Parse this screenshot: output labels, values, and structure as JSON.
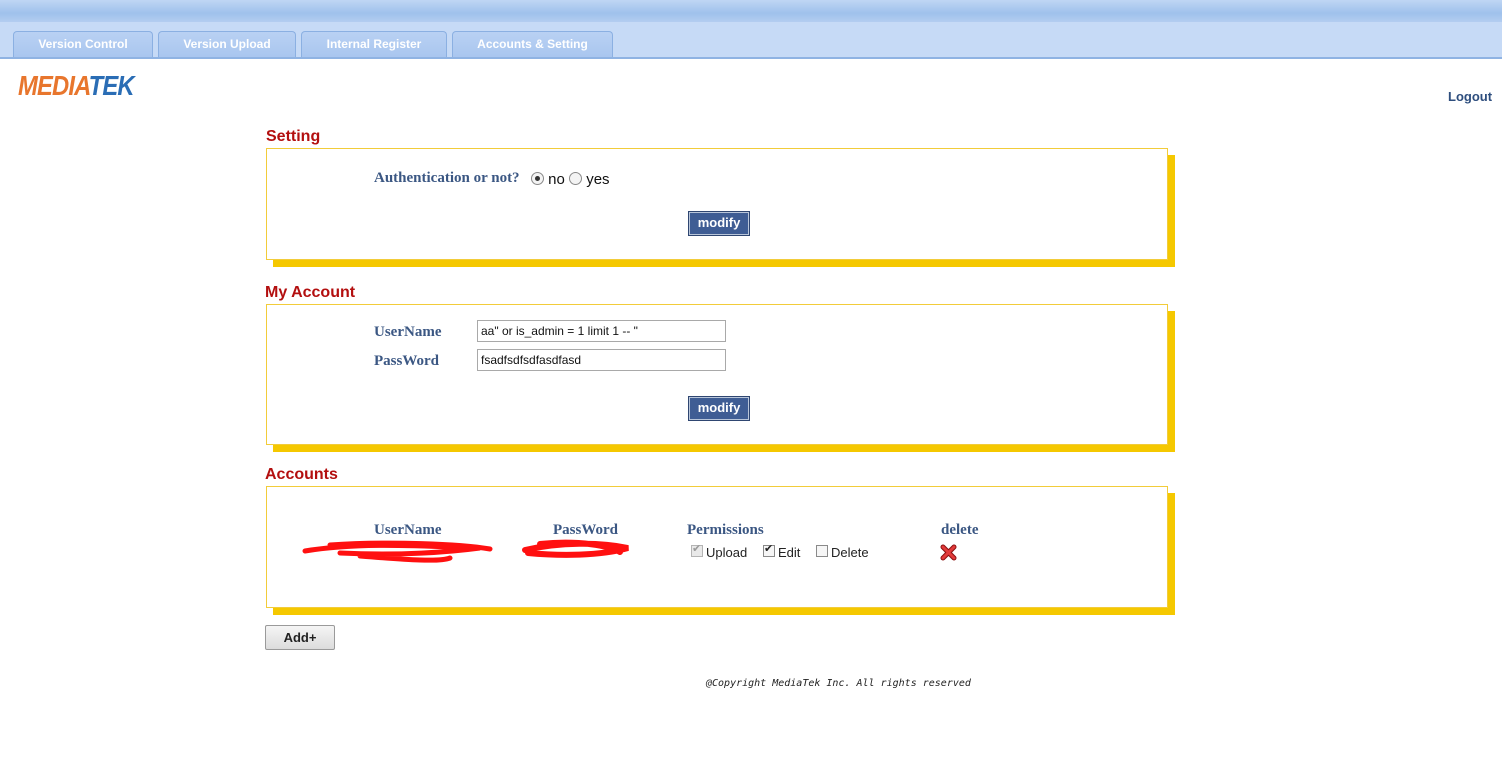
{
  "tabs": [
    {
      "label": "Version Control"
    },
    {
      "label": "Version Upload"
    },
    {
      "label": "Internal Register"
    },
    {
      "label": "Accounts & Setting"
    }
  ],
  "brand": {
    "logo_part1": "MEDIA",
    "logo_part2": "TEK"
  },
  "header": {
    "logout_label": "Logout"
  },
  "setting": {
    "title": "Setting",
    "auth_label": "Authentication or not?",
    "option_no": "no",
    "option_yes": "yes",
    "selected": "no",
    "modify_label": "modify"
  },
  "my_account": {
    "title": "My Account",
    "username_label": "UserName",
    "password_label": "PassWord",
    "username_value": "aa\" or is_admin = 1 limit 1 -- \"",
    "password_value": "fsadfsdfsdfasdfasd",
    "modify_label": "modify"
  },
  "accounts": {
    "title": "Accounts",
    "columns": {
      "username": "UserName",
      "password": "PassWord",
      "permissions": "Permissions",
      "delete": "delete"
    },
    "rows": [
      {
        "username": "[redacted]",
        "password": "[redacted]",
        "permissions": [
          {
            "label": "Upload",
            "checked": true,
            "disabled": true
          },
          {
            "label": "Edit",
            "checked": true,
            "disabled": false
          },
          {
            "label": "Delete",
            "checked": false,
            "disabled": false
          }
        ],
        "delete_icon": "red-x-icon"
      }
    ],
    "add_label": "Add+"
  },
  "footer": {
    "copyright": "@Copyright MediaTek Inc. All rights reserved"
  },
  "colors": {
    "section_title": "#b30f0f",
    "label": "#3b5783",
    "panel_shadow": "#f5c800",
    "button": "#3f5d94",
    "tabbar": "#c6daf6"
  }
}
